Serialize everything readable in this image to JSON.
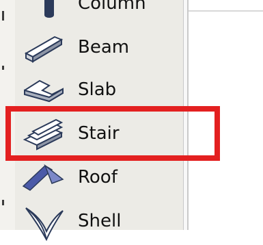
{
  "menu": {
    "items": [
      {
        "label": "Column",
        "icon": "column-icon"
      },
      {
        "label": "Beam",
        "icon": "beam-icon"
      },
      {
        "label": "Slab",
        "icon": "slab-icon"
      },
      {
        "label": "Stair",
        "icon": "stair-icon"
      },
      {
        "label": "Roof",
        "icon": "roof-icon"
      },
      {
        "label": "Shell",
        "icon": "shell-icon"
      }
    ]
  },
  "highlight": {
    "target": "Stair",
    "color": "#e32020"
  },
  "colors": {
    "menu_bg": "#ecebe6",
    "icon_fill": "#ffffff",
    "icon_stroke": "#2b3a5a",
    "roof_fill": "#4b5aa8"
  }
}
